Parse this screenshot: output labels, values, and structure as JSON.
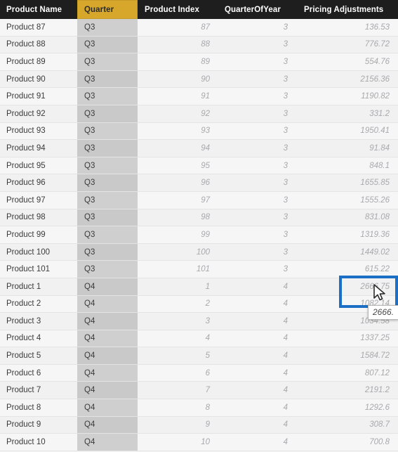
{
  "table": {
    "columns": [
      {
        "key": "product_name",
        "label": "Product Name",
        "highlighted": false
      },
      {
        "key": "quarter",
        "label": "Quarter",
        "highlighted": true
      },
      {
        "key": "product_index",
        "label": "Product Index",
        "highlighted": false
      },
      {
        "key": "quarter_of_year",
        "label": "QuarterOfYear",
        "highlighted": false
      },
      {
        "key": "pricing_adjustments",
        "label": "Pricing Adjustments",
        "highlighted": false
      }
    ],
    "rows": [
      {
        "product_name": "Product 87",
        "quarter": "Q3",
        "product_index": "87",
        "quarter_of_year": "3",
        "pricing_adjustments": "136.53"
      },
      {
        "product_name": "Product 88",
        "quarter": "Q3",
        "product_index": "88",
        "quarter_of_year": "3",
        "pricing_adjustments": "776.72"
      },
      {
        "product_name": "Product 89",
        "quarter": "Q3",
        "product_index": "89",
        "quarter_of_year": "3",
        "pricing_adjustments": "554.76"
      },
      {
        "product_name": "Product 90",
        "quarter": "Q3",
        "product_index": "90",
        "quarter_of_year": "3",
        "pricing_adjustments": "2156.36"
      },
      {
        "product_name": "Product 91",
        "quarter": "Q3",
        "product_index": "91",
        "quarter_of_year": "3",
        "pricing_adjustments": "1190.82"
      },
      {
        "product_name": "Product 92",
        "quarter": "Q3",
        "product_index": "92",
        "quarter_of_year": "3",
        "pricing_adjustments": "331.2"
      },
      {
        "product_name": "Product 93",
        "quarter": "Q3",
        "product_index": "93",
        "quarter_of_year": "3",
        "pricing_adjustments": "1950.41"
      },
      {
        "product_name": "Product 94",
        "quarter": "Q3",
        "product_index": "94",
        "quarter_of_year": "3",
        "pricing_adjustments": "91.84"
      },
      {
        "product_name": "Product 95",
        "quarter": "Q3",
        "product_index": "95",
        "quarter_of_year": "3",
        "pricing_adjustments": "848.1"
      },
      {
        "product_name": "Product 96",
        "quarter": "Q3",
        "product_index": "96",
        "quarter_of_year": "3",
        "pricing_adjustments": "1655.85"
      },
      {
        "product_name": "Product 97",
        "quarter": "Q3",
        "product_index": "97",
        "quarter_of_year": "3",
        "pricing_adjustments": "1555.26"
      },
      {
        "product_name": "Product 98",
        "quarter": "Q3",
        "product_index": "98",
        "quarter_of_year": "3",
        "pricing_adjustments": "831.08"
      },
      {
        "product_name": "Product 99",
        "quarter": "Q3",
        "product_index": "99",
        "quarter_of_year": "3",
        "pricing_adjustments": "1319.36"
      },
      {
        "product_name": "Product 100",
        "quarter": "Q3",
        "product_index": "100",
        "quarter_of_year": "3",
        "pricing_adjustments": "1449.02"
      },
      {
        "product_name": "Product 101",
        "quarter": "Q3",
        "product_index": "101",
        "quarter_of_year": "3",
        "pricing_adjustments": "615.22"
      },
      {
        "product_name": "Product 1",
        "quarter": "Q4",
        "product_index": "1",
        "quarter_of_year": "4",
        "pricing_adjustments": "2666.75"
      },
      {
        "product_name": "Product 2",
        "quarter": "Q4",
        "product_index": "2",
        "quarter_of_year": "4",
        "pricing_adjustments": "1082.14"
      },
      {
        "product_name": "Product 3",
        "quarter": "Q4",
        "product_index": "3",
        "quarter_of_year": "4",
        "pricing_adjustments": "1034.58"
      },
      {
        "product_name": "Product 4",
        "quarter": "Q4",
        "product_index": "4",
        "quarter_of_year": "4",
        "pricing_adjustments": "1337.25"
      },
      {
        "product_name": "Product 5",
        "quarter": "Q4",
        "product_index": "5",
        "quarter_of_year": "4",
        "pricing_adjustments": "1584.72"
      },
      {
        "product_name": "Product 6",
        "quarter": "Q4",
        "product_index": "6",
        "quarter_of_year": "4",
        "pricing_adjustments": "807.12"
      },
      {
        "product_name": "Product 7",
        "quarter": "Q4",
        "product_index": "7",
        "quarter_of_year": "4",
        "pricing_adjustments": "2191.2"
      },
      {
        "product_name": "Product 8",
        "quarter": "Q4",
        "product_index": "8",
        "quarter_of_year": "4",
        "pricing_adjustments": "1292.6"
      },
      {
        "product_name": "Product 9",
        "quarter": "Q4",
        "product_index": "9",
        "quarter_of_year": "4",
        "pricing_adjustments": "308.7"
      },
      {
        "product_name": "Product 10",
        "quarter": "Q4",
        "product_index": "10",
        "quarter_of_year": "4",
        "pricing_adjustments": "700.8"
      }
    ]
  },
  "annotation": {
    "tooltip_value": "2666.",
    "selection_color": "#1b6fc4",
    "header_highlight_color": "#d6a72a"
  }
}
